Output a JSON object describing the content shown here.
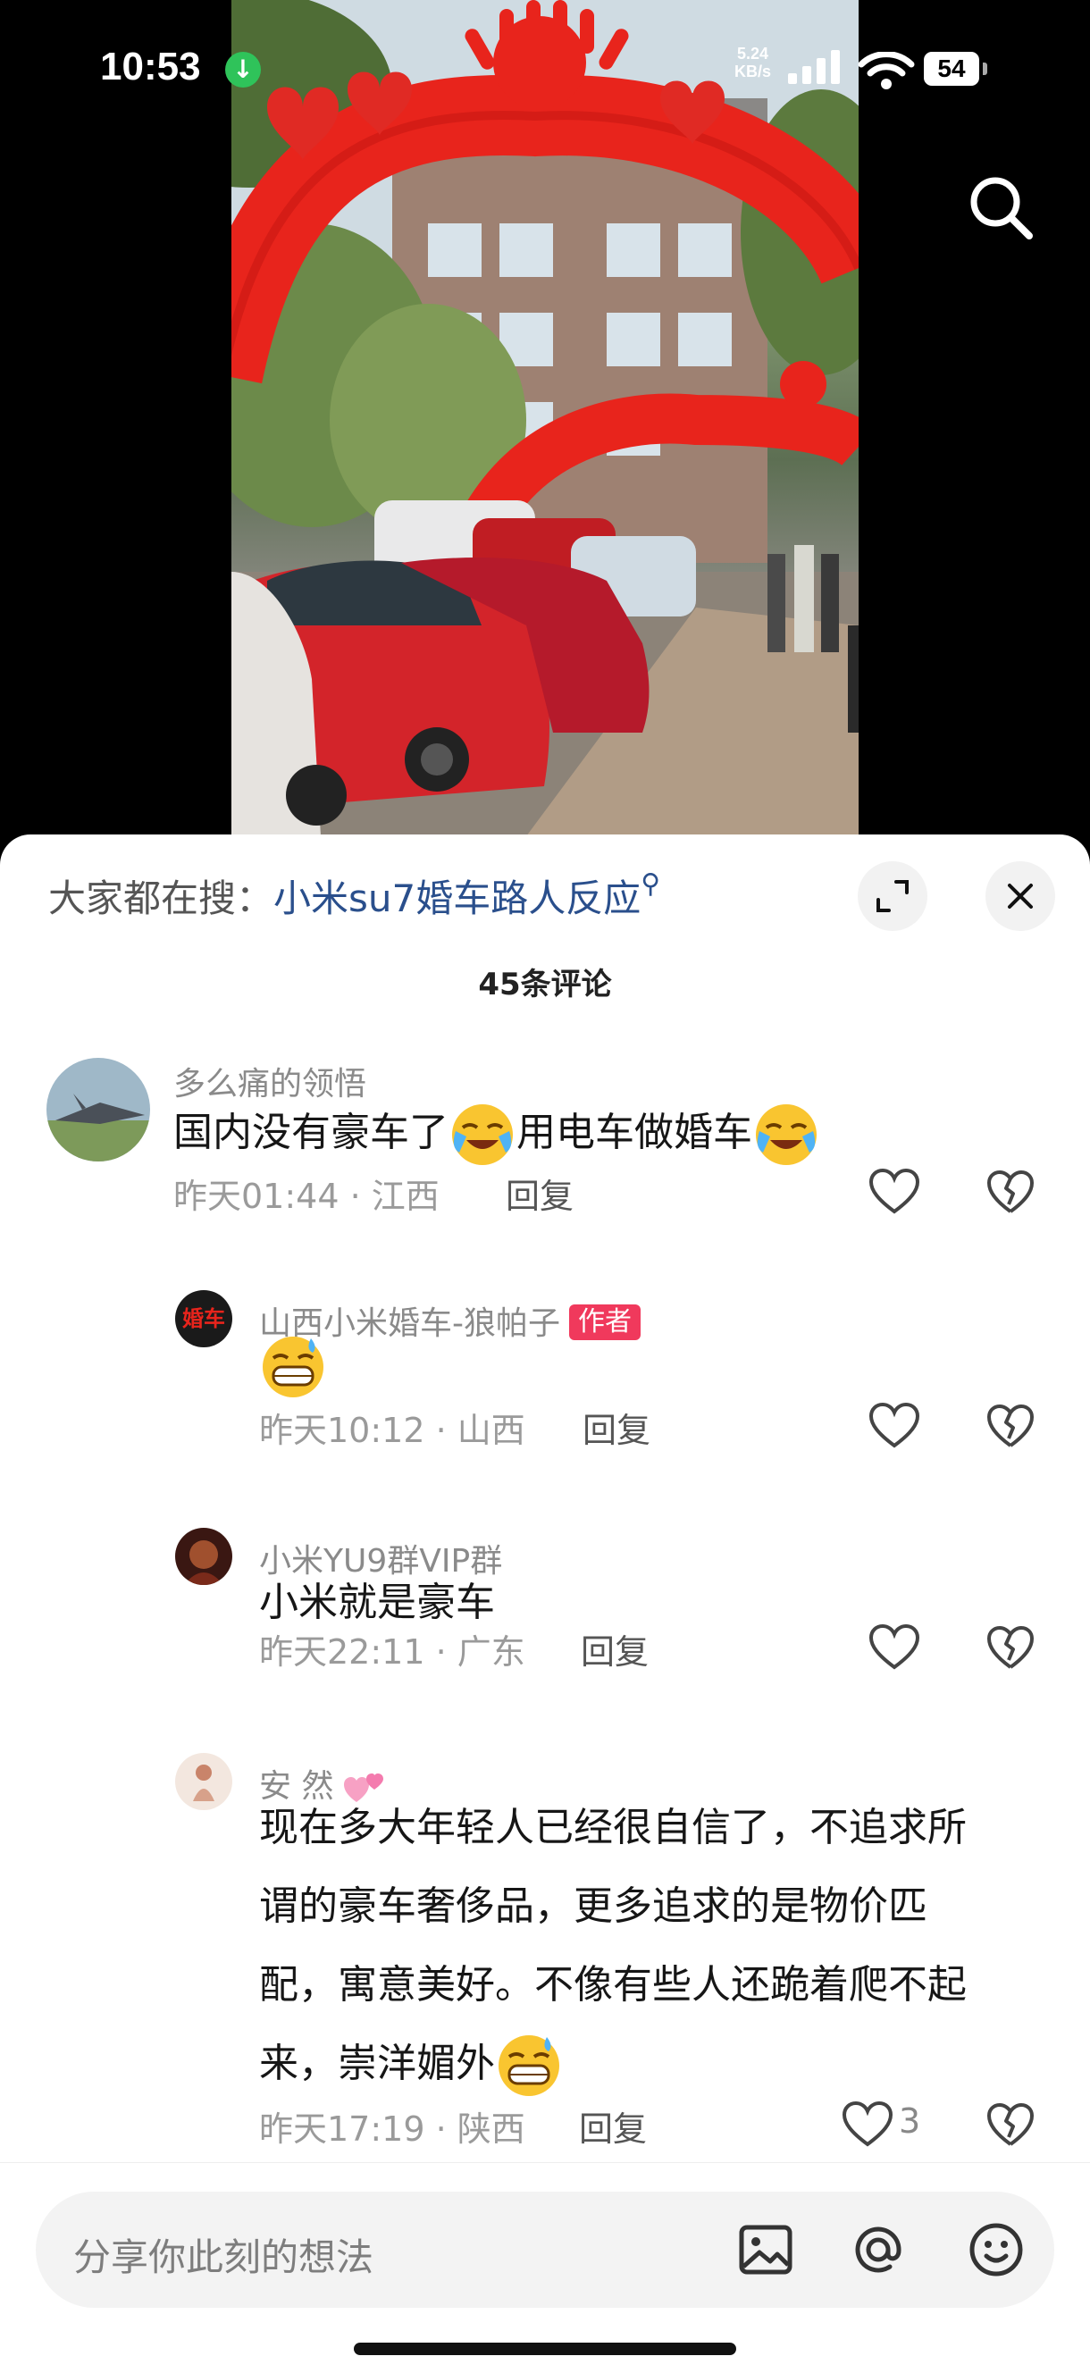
{
  "status_bar": {
    "time": "10:53",
    "notification_icon": "download-arrow-icon",
    "net_speed_top": "5.24",
    "net_speed_bottom": "KB/s",
    "signal_label": "4G",
    "wifi_label": "7",
    "battery": "54"
  },
  "header": {
    "search_prefix": "大家都在搜：",
    "search_keyword": "小米su7婚车路人反应",
    "comment_count": "45条评论"
  },
  "comments": [
    {
      "user": "多么痛的领悟",
      "text_a": "国内没有豪车了",
      "text_b": "用电车做婚车",
      "time": "昨天01:44 · 江西",
      "reply": "回复"
    },
    {
      "user": "山西小米婚车-狼帕子",
      "badge": "作者",
      "avatar_text": "婚车",
      "time": "昨天10:12 · 山西",
      "reply": "回复"
    },
    {
      "user": "小米YU9群VIP群",
      "text": "小米就是豪车",
      "time": "昨天22:11 · 广东",
      "reply": "回复"
    },
    {
      "user": "安 然",
      "line1": "现在多大年轻人已经很自信了，不追求所",
      "line2": "谓的豪车奢侈品，更多追求的是物价匹",
      "line3": "配，寓意美好。不像有些人还跪着爬不起",
      "line4": "来，崇洋媚外",
      "time": "昨天17:19 · 陕西",
      "reply": "回复",
      "likes": "3"
    }
  ],
  "input": {
    "placeholder": "分享你此刻的想法"
  },
  "colors": {
    "keyword": "#2a4f8c",
    "author_badge": "#f0395c",
    "arch_red": "#e8241c"
  }
}
